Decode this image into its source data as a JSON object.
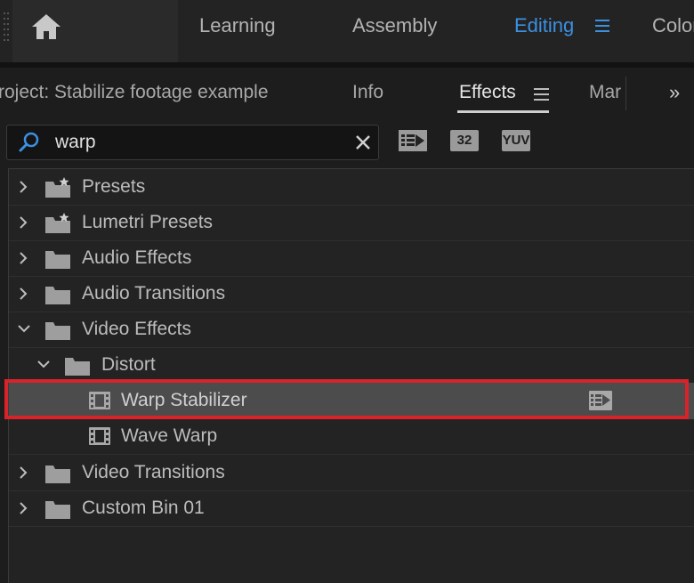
{
  "workspaces": {
    "items": [
      {
        "label": "Learning",
        "active": false
      },
      {
        "label": "Assembly",
        "active": false
      },
      {
        "label": "Editing",
        "active": true
      },
      {
        "label": "Color",
        "active": false
      }
    ],
    "accent_color": "#3c90e0",
    "home_icon": "home-icon",
    "menu_icon": "hamburger-menu-icon"
  },
  "panel_tabs": {
    "items": [
      {
        "label": "roject: Stabilize footage example",
        "active": false
      },
      {
        "label": "Info",
        "active": false
      },
      {
        "label": "Effects",
        "active": true
      },
      {
        "label": "Mar",
        "active": false
      }
    ],
    "overflow_label": "»"
  },
  "search": {
    "value": "warp",
    "search_icon": "magnifier-icon",
    "clear_icon": "close-icon"
  },
  "filters": [
    {
      "name": "accelerated-effects-filter",
      "label": ""
    },
    {
      "name": "32-bit-filter",
      "label": "32"
    },
    {
      "name": "yuv-filter",
      "label": "YUV"
    }
  ],
  "tree": {
    "rows": [
      {
        "label": "Presets",
        "expanded": false,
        "type": "preset-bin"
      },
      {
        "label": "Lumetri Presets",
        "expanded": false,
        "type": "preset-bin"
      },
      {
        "label": "Audio Effects",
        "expanded": false,
        "type": "bin"
      },
      {
        "label": "Audio Transitions",
        "expanded": false,
        "type": "bin"
      },
      {
        "label": "Video Effects",
        "expanded": true,
        "type": "bin"
      },
      {
        "label": "Distort",
        "expanded": true,
        "type": "bin"
      },
      {
        "label": "Warp Stabilizer",
        "type": "effect",
        "selected": true,
        "accelerated": true
      },
      {
        "label": "Wave Warp",
        "type": "effect",
        "selected": false
      },
      {
        "label": "Video Transitions",
        "expanded": false,
        "type": "bin"
      },
      {
        "label": "Custom Bin 01",
        "expanded": false,
        "type": "bin"
      }
    ],
    "highlight_color": "#d8232a"
  }
}
